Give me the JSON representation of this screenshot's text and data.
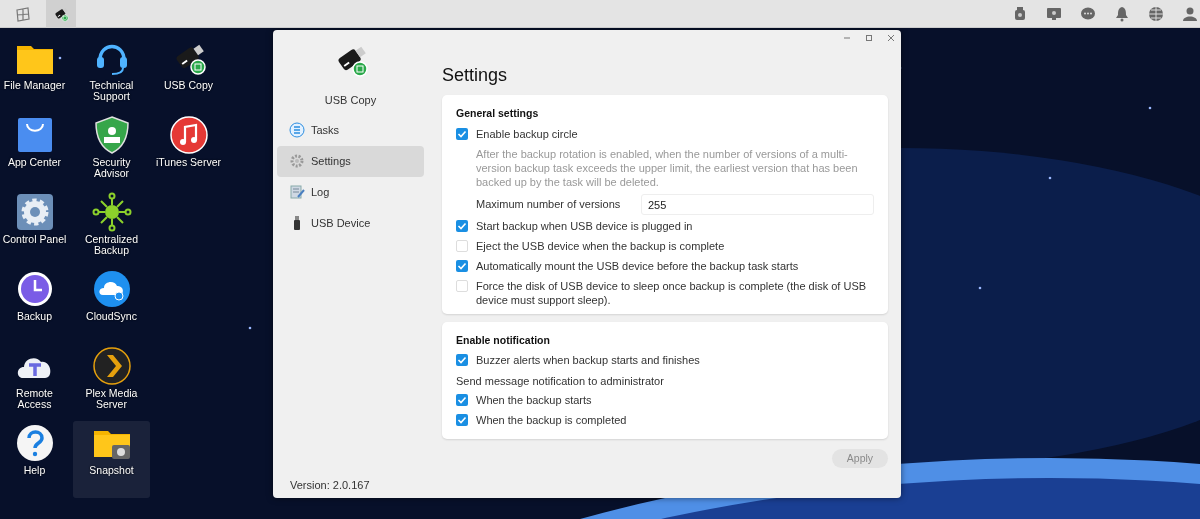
{
  "taskbar": {
    "apps": [
      {
        "selected": false
      },
      {
        "selected": true
      }
    ]
  },
  "desktop": {
    "columns": [
      [
        {
          "label": "File Manager",
          "selected": false
        },
        {
          "label": "App Center",
          "selected": false
        },
        {
          "label": "Control Panel",
          "selected": false
        },
        {
          "label": "Backup",
          "selected": false
        },
        {
          "label": "Remote Access",
          "selected": false
        },
        {
          "label": "Help",
          "selected": false
        }
      ],
      [
        {
          "label": "Technical Support",
          "selected": false
        },
        {
          "label": "Security Advisor",
          "selected": false
        },
        {
          "label": "Centralized Backup",
          "selected": false
        },
        {
          "label": "CloudSync",
          "selected": false
        },
        {
          "label": "Plex Media Server",
          "selected": false
        },
        {
          "label": "Snapshot",
          "selected": true
        }
      ],
      [
        {
          "label": "USB Copy",
          "selected": false
        },
        {
          "label": "iTunes Server",
          "selected": false
        }
      ]
    ]
  },
  "window": {
    "app_name": "USB Copy",
    "sidebar": {
      "items": [
        {
          "label": "Tasks",
          "selected": false
        },
        {
          "label": "Settings",
          "selected": true
        },
        {
          "label": "Log",
          "selected": false
        },
        {
          "label": "USB Device",
          "selected": false
        }
      ],
      "version": "Version: 2.0.167"
    },
    "title": "Settings",
    "sections": [
      {
        "title": "General settings",
        "items": [
          {
            "kind": "checkbox",
            "label": "Enable backup circle",
            "checked": true
          },
          {
            "kind": "note",
            "text": "After the backup rotation is enabled, when the number of versions of a multi-version backup task exceeds the upper limit, the earliest version that has been backed up by the task will be deleted."
          },
          {
            "kind": "field",
            "label": "Maximum number of versions",
            "value": "255"
          },
          {
            "kind": "checkbox",
            "label": "Start backup when USB device is plugged in",
            "checked": true
          },
          {
            "kind": "checkbox",
            "label": "Eject the USB device when the backup is complete",
            "checked": false
          },
          {
            "kind": "checkbox",
            "label": "Automatically mount the USB device before the backup task starts",
            "checked": true
          },
          {
            "kind": "checkbox",
            "label": "Force the disk of USB device to sleep once backup is complete (the disk of USB device must support sleep).",
            "checked": false
          }
        ]
      },
      {
        "title": "Enable notification",
        "items": [
          {
            "kind": "checkbox",
            "label": "Buzzer alerts when backup starts and finishes",
            "checked": true
          },
          {
            "kind": "text",
            "text": "Send message notification to administrator"
          },
          {
            "kind": "checkbox",
            "label": "When the backup starts",
            "checked": true
          },
          {
            "kind": "checkbox",
            "label": "When the backup is completed",
            "checked": true
          }
        ]
      }
    ],
    "apply_button": {
      "label": "Apply",
      "disabled": true
    }
  }
}
